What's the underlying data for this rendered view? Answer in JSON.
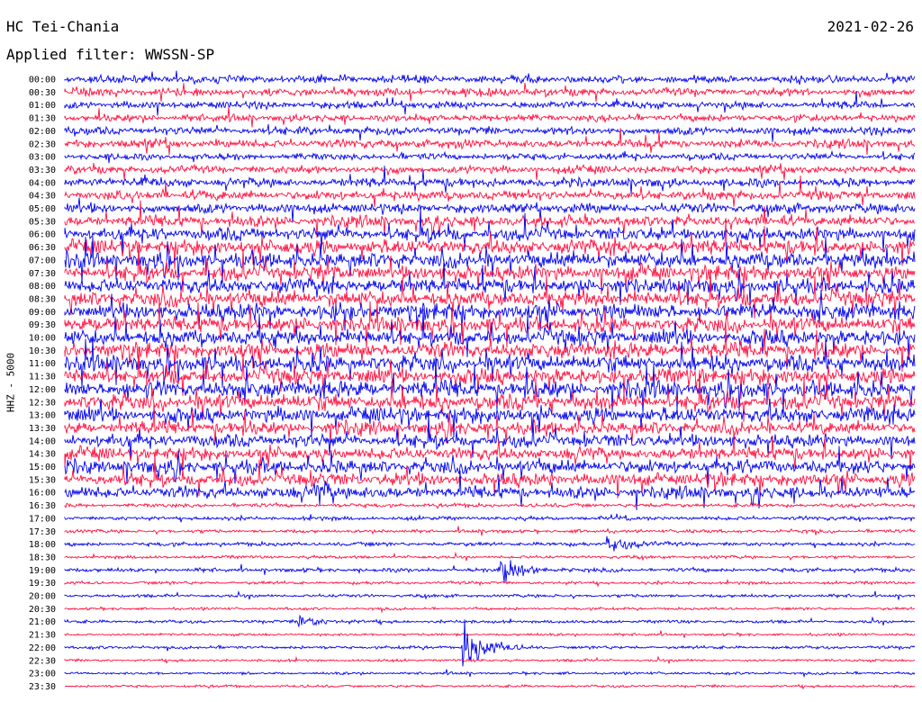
{
  "header": {
    "station": "HC Tei-Chania",
    "date": "2021-02-26",
    "filter_label": "Applied filter: WWSSN-SP"
  },
  "chart_data": {
    "type": "line",
    "channel_label": "HHZ - 5000",
    "row_labels": [
      "00:00",
      "00:30",
      "01:00",
      "01:30",
      "02:00",
      "02:30",
      "03:00",
      "03:30",
      "04:00",
      "04:30",
      "05:00",
      "05:30",
      "06:00",
      "06:30",
      "07:00",
      "07:30",
      "08:00",
      "08:30",
      "09:00",
      "09:30",
      "10:00",
      "10:30",
      "11:00",
      "11:30",
      "12:00",
      "12:30",
      "13:00",
      "13:30",
      "14:00",
      "14:30",
      "15:00",
      "15:30",
      "16:00",
      "16:30",
      "17:00",
      "17:30",
      "18:00",
      "18:30",
      "19:00",
      "19:30",
      "20:00",
      "20:30",
      "21:00",
      "21:30",
      "22:00",
      "22:30",
      "23:00",
      "23:30"
    ],
    "colors": {
      "odd": "#0000ee",
      "even": "#ff1040"
    },
    "noise_level": [
      0.3,
      0.3,
      0.28,
      0.28,
      0.3,
      0.32,
      0.26,
      0.3,
      0.34,
      0.36,
      0.38,
      0.42,
      0.5,
      0.56,
      0.6,
      0.58,
      0.55,
      0.6,
      0.62,
      0.58,
      0.6,
      0.58,
      0.62,
      0.6,
      0.64,
      0.6,
      0.58,
      0.5,
      0.5,
      0.48,
      0.52,
      0.5,
      0.45,
      0.15,
      0.15,
      0.13,
      0.15,
      0.12,
      0.15,
      0.12,
      0.12,
      0.1,
      0.12,
      0.1,
      0.12,
      0.1,
      0.1,
      0.1
    ],
    "events": [
      {
        "row": 38,
        "minute": 15.5,
        "amplitude": 1.4
      },
      {
        "row": 44,
        "minute": 14.2,
        "amplitude": 2.6
      },
      {
        "row": 42,
        "minute": 8.4,
        "amplitude": 0.8
      },
      {
        "row": 36,
        "minute": 19.3,
        "amplitude": 0.9
      },
      {
        "row": 32,
        "minute": 9.0,
        "amplitude": 1.0
      }
    ]
  }
}
